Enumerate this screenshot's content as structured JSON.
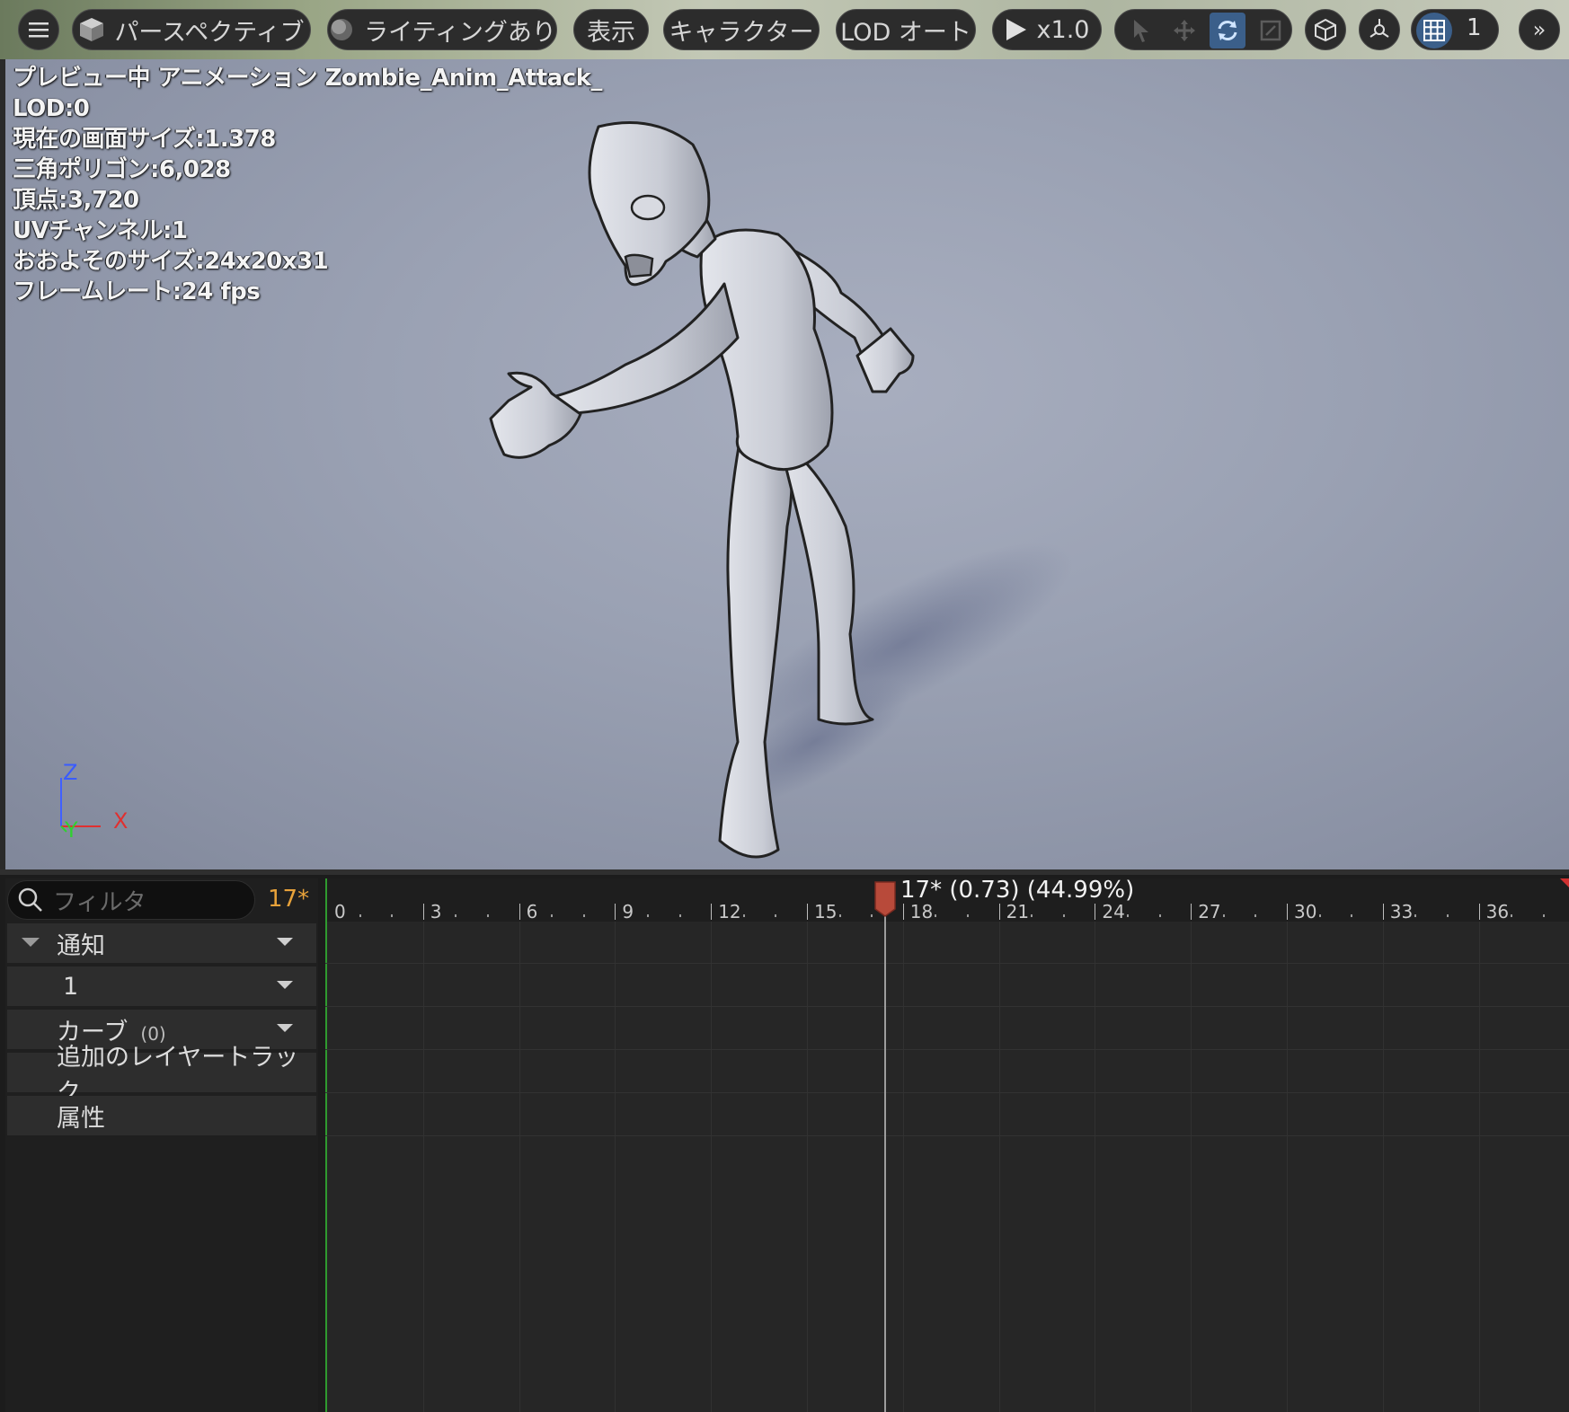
{
  "toolbar": {
    "perspective_label": "パースペクティブ",
    "lighting_label": "ライティングあり",
    "show_label": "表示",
    "character_label": "キャラクター",
    "lod_label": "LOD オート",
    "playback_speed": "x1.0",
    "grid_value": "1"
  },
  "stats": {
    "line1": "プレビュー中 アニメーション Zombie_Anim_Attack_",
    "line2": "LOD:0",
    "line3": "現在の画面サイズ:1.378",
    "line4": "三角ポリゴン:6,028",
    "line5": "頂点:3,720",
    "line6": "UVチャンネル:1",
    "line7": "おおよそのサイズ:24x20x31",
    "line8": "フレームレート:24 fps"
  },
  "axes": {
    "z": "Z",
    "x": "X",
    "y": "Y"
  },
  "panel": {
    "filter_placeholder": "フィルタ",
    "current_frame": "17*",
    "tracks": {
      "notify": "通知",
      "notify_sub": "1",
      "curves": "カーブ",
      "curves_count": "(0)",
      "additive": "追加のレイヤートラック",
      "attributes": "属性"
    }
  },
  "timeline": {
    "playhead_text": "17* (0.73) (44.99%)",
    "ticks": [
      "0",
      "3",
      "6",
      "9",
      "12",
      "15",
      "18",
      "21",
      "24",
      "27",
      "30",
      "33",
      "36"
    ],
    "playhead_frame": 17
  },
  "colors": {
    "accent_orange": "#e8a23a",
    "playhead_red": "#b84a3a",
    "selected_blue": "#3b5f8a"
  }
}
